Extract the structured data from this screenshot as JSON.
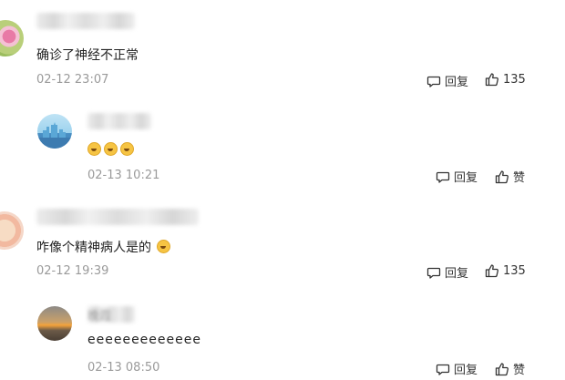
{
  "comments": [
    {
      "text": "确诊了神经不正常",
      "time": "02-12 23:07",
      "reply_label": "回复",
      "like_count": "135",
      "replies": [
        {
          "text_icons": [
            "laugh-cry-emoji",
            "laugh-cry-emoji",
            "laugh-cry-emoji"
          ],
          "time": "02-13 10:21",
          "reply_label": "回复",
          "like_label": "赞"
        }
      ]
    },
    {
      "text": "咋像个精神病人是的",
      "text_icon": "smile-emoji",
      "time": "02-12 19:39",
      "reply_label": "回复",
      "like_count": "135",
      "replies": [
        {
          "text": "eeeeeeeeeeeee",
          "name_partial": "晚霞",
          "time": "02-13 08:50",
          "reply_label": "回复",
          "like_label": "赞"
        }
      ]
    }
  ],
  "colors": {
    "time": "#9a9a9a",
    "text": "#222222",
    "action": "#333333"
  }
}
